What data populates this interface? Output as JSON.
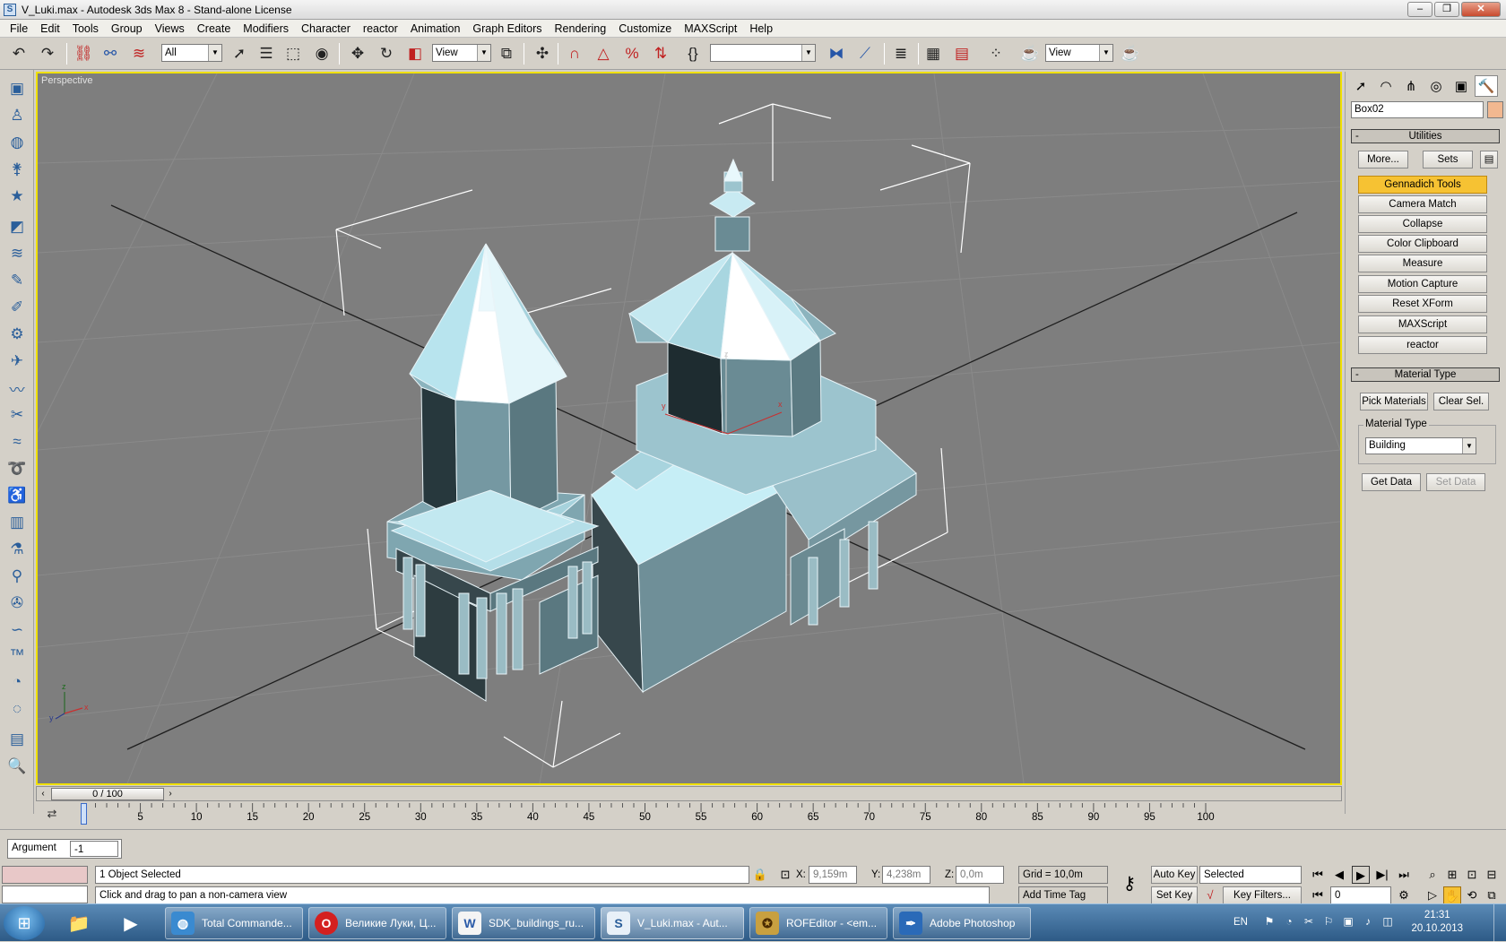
{
  "window": {
    "title": "V_Luki.max - Autodesk 3ds Max 8  - Stand-alone License",
    "minimize": "–",
    "restore": "❐",
    "close": "✕"
  },
  "menu": [
    "File",
    "Edit",
    "Tools",
    "Group",
    "Views",
    "Create",
    "Modifiers",
    "Character",
    "reactor",
    "Animation",
    "Graph Editors",
    "Rendering",
    "Customize",
    "MAXScript",
    "Help"
  ],
  "toolbar": {
    "selection_filter": "All",
    "ref_coord": "View",
    "named_selection": "",
    "view_right": "View"
  },
  "viewport": {
    "label": "Perspective",
    "axis_x": "x",
    "axis_y": "y",
    "axis_z": "z"
  },
  "command_panel": {
    "object_name": "Box02",
    "utilities": {
      "header": "Utilities",
      "more": "More...",
      "sets": "Sets",
      "items": [
        "Gennadich Tools",
        "Camera Match",
        "Collapse",
        "Color Clipboard",
        "Measure",
        "Motion Capture",
        "Reset XForm",
        "MAXScript",
        "reactor"
      ]
    },
    "material_type": {
      "header": "Material Type",
      "pick": "Pick Materials",
      "clear": "Clear Sel.",
      "group_label": "Material Type",
      "selected": "Building",
      "get": "Get Data",
      "set": "Set Data"
    }
  },
  "time_slider": {
    "label": "0 / 100",
    "ticks": [
      "0",
      "5",
      "10",
      "15",
      "20",
      "25",
      "30",
      "35",
      "40",
      "45",
      "50",
      "55",
      "60",
      "65",
      "70",
      "75",
      "80",
      "85",
      "90",
      "95",
      "100"
    ]
  },
  "status": {
    "argument_label": "Argument",
    "argument_value": "-1",
    "selection": "1 Object Selected",
    "prompt": "Click and drag to pan a non-camera view",
    "x_label": "X:",
    "x_value": "9,159m",
    "y_label": "Y:",
    "y_value": "4,238m",
    "z_label": "Z:",
    "z_value": "0,0m",
    "grid": "Grid = 10,0m",
    "add_time_tag": "Add Time Tag",
    "auto_key": "Auto Key",
    "set_key": "Set Key",
    "key_mode": "Selected",
    "key_filters": "Key Filters...",
    "frame": "0"
  },
  "taskbar": {
    "tasks": [
      "Total Commande...",
      "Великие Луки, Ц...",
      "SDK_buildings_ru...",
      "V_Luki.max - Aut...",
      "ROFEditor - <em...",
      "Adobe Photoshop"
    ],
    "lang": "EN",
    "time": "21:31",
    "date": "20.10.2013"
  },
  "colors": {
    "viewport_bg": "#7e7e7e",
    "active_border": "#f0e000",
    "model_fill": "#7aa0aa",
    "roof_light": "#b8e0e8",
    "highlight_button": "#f6c233"
  }
}
